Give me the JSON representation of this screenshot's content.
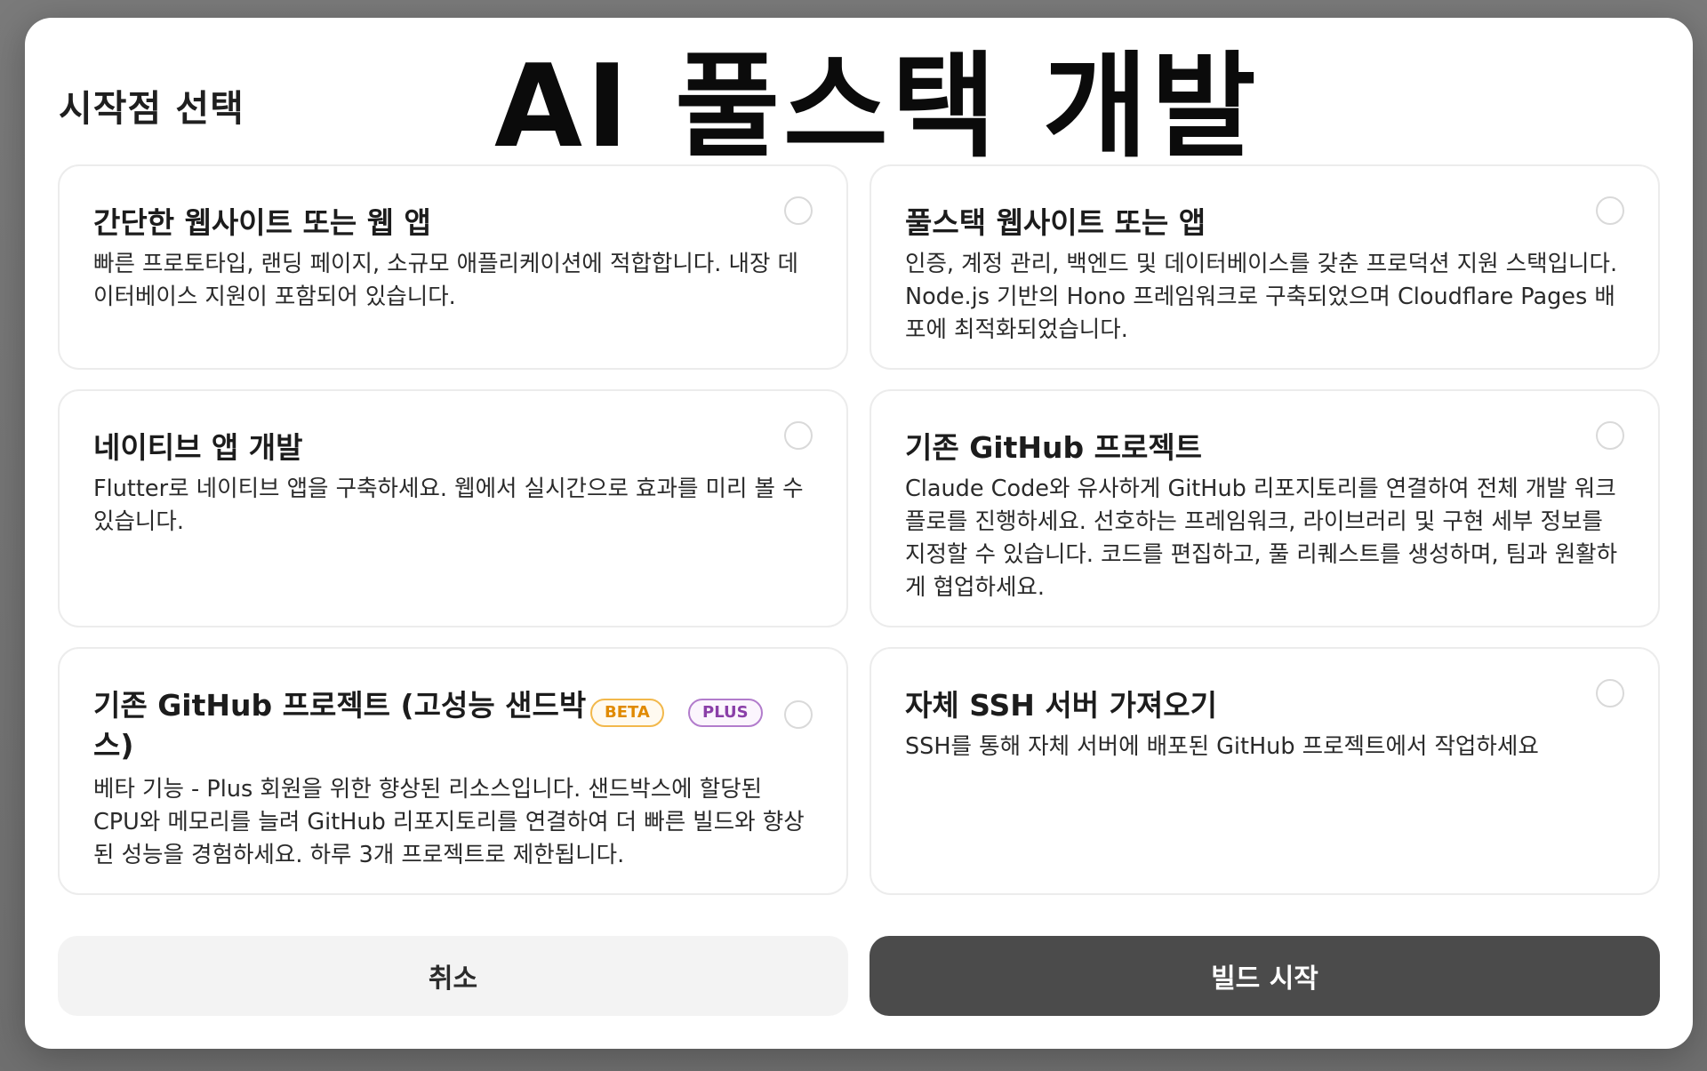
{
  "overlay_title": "AI 풀스택 개발",
  "modal": {
    "title": "시작점 선택",
    "options": [
      {
        "title": "간단한 웹사이트 또는 웹 앱",
        "description": "빠른 프로토타입, 랜딩 페이지, 소규모 애플리케이션에 적합합니다. 내장 데이터베이스 지원이 포함되어 있습니다.",
        "selected": false
      },
      {
        "title": "풀스택 웹사이트 또는 앱",
        "description": "인증, 계정 관리, 백엔드 및 데이터베이스를 갖춘 프로덕션 지원 스택입니다. Node.js 기반의 Hono 프레임워크로 구축되었으며 Cloudflare Pages 배포에 최적화되었습니다.",
        "selected": false
      },
      {
        "title": "네이티브 앱 개발",
        "description": "Flutter로 네이티브 앱을 구축하세요. 웹에서 실시간으로 효과를 미리 볼 수 있습니다.",
        "selected": false
      },
      {
        "title": "기존 GitHub 프로젝트",
        "description": "Claude Code와 유사하게 GitHub 리포지토리를 연결하여 전체 개발 워크플로를 진행하세요. 선호하는 프레임워크, 라이브러리 및 구현 세부 정보를 지정할 수 있습니다. 코드를 편집하고, 풀 리퀘스트를 생성하며, 팀과 원활하게 협업하세요.",
        "selected": false
      },
      {
        "title": "기존 GitHub 프로젝트 (고성능 샌드박스)",
        "description": "베타 기능 - Plus 회원을 위한 향상된 리소스입니다. 샌드박스에 할당된 CPU와 메모리를 늘려 GitHub 리포지토리를 연결하여 더 빠른 빌드와 향상된 성능을 경험하세요. 하루 3개 프로젝트로 제한됩니다.",
        "badges": [
          "BETA",
          "PLUS"
        ],
        "selected": false
      },
      {
        "title": "자체 SSH 서버 가져오기",
        "description": "SSH를 통해 자체 서버에 배포된 GitHub 프로젝트에서 작업하세요",
        "selected": false
      }
    ],
    "buttons": {
      "cancel": "취소",
      "start": "빌드 시작"
    }
  }
}
